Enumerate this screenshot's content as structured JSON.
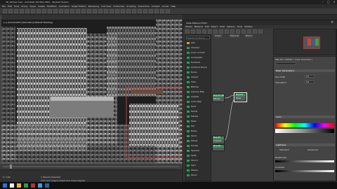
{
  "window": {
    "title": "3D_kitchen.max - Autodesk 3ds Max 2021 - Student Version"
  },
  "menu": [
    "File",
    "Edit",
    "Tools",
    "Group",
    "Views",
    "Create",
    "Modifiers",
    "Animation",
    "Graph Editors",
    "Rendering",
    "Civil View",
    "Customize",
    "Scripting",
    "Interactive",
    "Content",
    "Arnold",
    "Help"
  ],
  "viewport": {
    "label": "[+] [Camera001] [Standard] [Default Shading]"
  },
  "slate": {
    "title": "Slate Material Editor",
    "menu": [
      "Modes",
      "Material",
      "Edit",
      "Select",
      "View",
      "Options",
      "Tools",
      "Utilities"
    ],
    "search_placeholder": "Search by Name ...",
    "browser_items": [
      {
        "label": "OSL",
        "color": "#c8a040"
      },
      {
        "label": "Checker",
        "color": "#2d9b5a"
      },
      {
        "label": "Color Correct",
        "color": "#2d9b5a"
      },
      {
        "label": "Composite",
        "color": "#2d9b5a"
      },
      {
        "label": "Gradient",
        "color": "#2d9b5a"
      },
      {
        "label": "Gradient Ramp",
        "color": "#2d9b5a"
      },
      {
        "label": "Noise",
        "color": "#2d9b5a"
      },
      {
        "label": "Output",
        "color": "#2d9b5a"
      },
      {
        "label": "Tiles",
        "color": "#2d9b5a"
      },
      {
        "label": "Bitmap",
        "color": "#2d9b5a"
      },
      {
        "label": "Camera Map",
        "color": "#2d9b5a"
      },
      {
        "label": "Cellular",
        "color": "#2d9b5a"
      },
      {
        "label": "Color Map",
        "color": "#2d9b5a"
      },
      {
        "label": "Dent",
        "color": "#2d9b5a"
      },
      {
        "label": "Falloff",
        "color": "#2d9b5a"
      },
      {
        "label": "Marble",
        "color": "#2d9b5a"
      },
      {
        "label": "Mask",
        "color": "#2d9b5a"
      },
      {
        "label": "Mix",
        "color": "#2d9b5a"
      },
      {
        "label": "Noise",
        "color": "#2d9b5a"
      },
      {
        "label": "Perlin",
        "color": "#2d9b5a"
      },
      {
        "label": "Planet",
        "color": "#2d9b5a"
      },
      {
        "label": "Smoke",
        "color": "#2d9b5a"
      },
      {
        "label": "Speckle",
        "color": "#2d9b5a"
      },
      {
        "label": "Splat",
        "color": "#2d9b5a"
      },
      {
        "label": "Stucco",
        "color": "#2d9b5a"
      },
      {
        "label": "Swirl",
        "color": "#2d9b5a"
      },
      {
        "label": "Waves",
        "color": "#2d9b5a"
      },
      {
        "label": "Wood",
        "color": "#2d9b5a"
      }
    ],
    "graph_tabs": [
      "View1",
      "Material",
      "Blend"
    ],
    "nodes": [
      {
        "title": "Map #3 (Bitmap)",
        "sub": "Bitmap"
      },
      {
        "title": "Map #4",
        "sub": "Noise"
      },
      {
        "title": "Map #5",
        "sub": "Gradient"
      },
      {
        "title": "Map #6",
        "sub": "Gradient"
      }
    ],
    "param": {
      "map_name": "Map #4 ( COLOR ) ( Color Correction )",
      "rollout_basic": "Basic Parameters",
      "rollout_color": "Color",
      "rollout_lightness": "Lightness",
      "hue_label": "Hue Shift",
      "sat_label": "Saturation",
      "lightness_std": "Standard",
      "lightness_adv": "Advanced",
      "brightness_label": "Brightness",
      "contrast_label": "Contrast",
      "value_zero": "0.0"
    }
  },
  "status": {
    "line1": "1 Objects Selected",
    "line2": "Click and drag to select and move objects"
  },
  "timeline": {
    "frame": "0 / 100"
  }
}
